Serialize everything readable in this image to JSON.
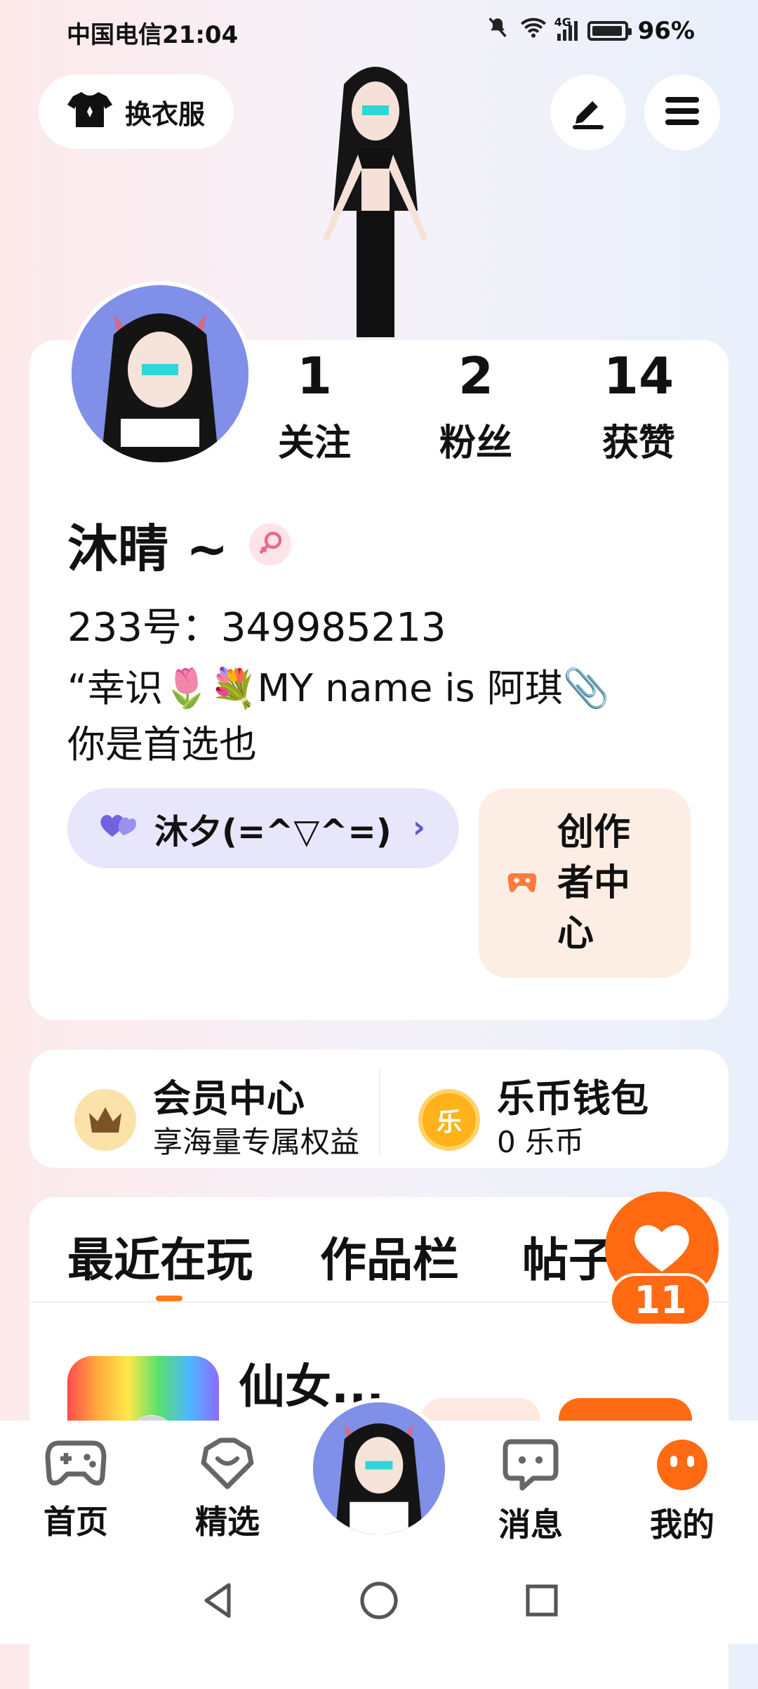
{
  "status_bar": {
    "carrier_time": "中国电信21:04",
    "network": "4G",
    "battery": "96%",
    "battery_level": 0.96
  },
  "top": {
    "outfit_button": "换衣服",
    "edit_icon": "pen-icon",
    "menu_icon": "hamburger-icon"
  },
  "profile": {
    "stats": [
      {
        "value": "1",
        "label": "关注"
      },
      {
        "value": "2",
        "label": "粉丝"
      },
      {
        "value": "14",
        "label": "获赞"
      }
    ],
    "name": "沐晴 ~",
    "gender_icon": "female-icon",
    "uid": "233号：349985213",
    "bio_line1": "“幸识🌷💐MY name is 阿琪📎",
    "bio_line2": "你是首选也",
    "guild": "沐夕(=^▽^=)",
    "creator_center": "创作者中心"
  },
  "wallet": {
    "vip_title": "会员中心",
    "vip_sub": "享海量专属权益",
    "coin_title": "乐币钱包",
    "coin_sub": "0 乐币",
    "coin_glyph": "乐"
  },
  "tabs": [
    "最近在玩",
    "作品栏",
    "帖子"
  ],
  "recent_game": {
    "name": "仙女..."
  },
  "like": {
    "count": "11"
  },
  "bottom_nav": [
    {
      "label": "首页",
      "icon": "gamepad-icon"
    },
    {
      "label": "精选",
      "icon": "heart-box-icon"
    },
    {
      "label": "消息",
      "icon": "chat-icon"
    },
    {
      "label": "我的",
      "icon": "face-icon"
    }
  ],
  "colors": {
    "accent": "#ff6a13",
    "guild_bg": "#e8e6fb",
    "creator_bg": "#fdeee5"
  }
}
